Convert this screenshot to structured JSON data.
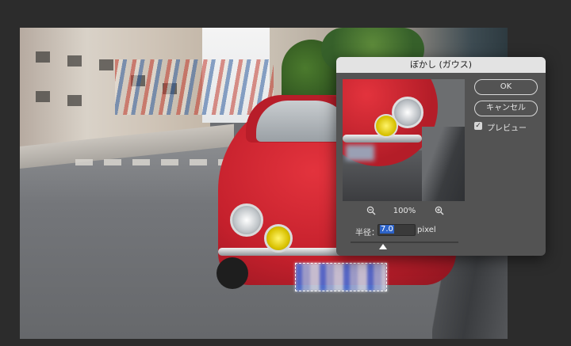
{
  "dialog": {
    "title": "ぼかし (ガウス)",
    "ok_label": "OK",
    "cancel_label": "キャンセル",
    "preview_label": "プレビュー",
    "preview_checked": true,
    "zoom_out_icon": "zoom-out-icon",
    "zoom_in_icon": "zoom-in-icon",
    "zoom_value": "100%",
    "radius_label": "半径：",
    "radius_value": "7.0",
    "radius_unit": "pixel"
  },
  "colors": {
    "dialog_bg": "#535353",
    "titlebar_bg": "#e3e3e3",
    "selection_highlight": "#2d63c8",
    "app_bg": "#2c2c2c"
  }
}
